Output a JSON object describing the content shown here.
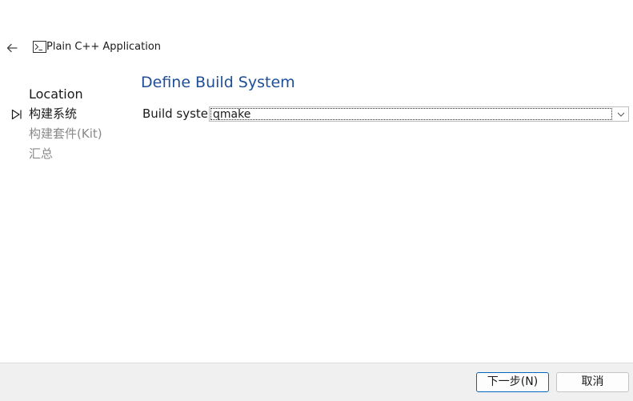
{
  "header": {
    "back_icon": "arrow-left-icon",
    "app_icon": "terminal-icon",
    "title": "Plain C++ Application"
  },
  "sidebar": {
    "steps": [
      {
        "label": "Location",
        "state": "done"
      },
      {
        "label": "构建系统",
        "state": "current",
        "marker_icon": "play-outline-icon"
      },
      {
        "label": "构建套件(Kit)",
        "state": "pending"
      },
      {
        "label": "汇总",
        "state": "pending"
      }
    ]
  },
  "main": {
    "title": "Define Build System",
    "build_system": {
      "label": "Build syste",
      "value": "qmake",
      "arrow_icon": "chevron-down-icon"
    }
  },
  "footer": {
    "next_label": "下一步(N)",
    "cancel_label": "取消"
  },
  "colors": {
    "title_blue": "#1f4e99",
    "pending_gray": "#8a8a8a",
    "footer_bg": "#f0f0f0",
    "focus_border": "#0067c0"
  }
}
